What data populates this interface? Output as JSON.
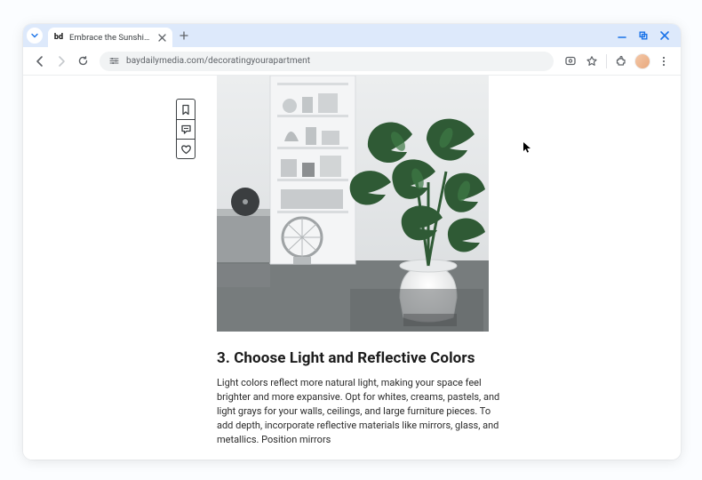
{
  "browser": {
    "tab_title": "Embrace the Sunshine: Dec…",
    "favicon_text": "bd",
    "url": "baydailymedia.com/decoratingyourapartment"
  },
  "side_actions": {
    "bookmark_label": "bookmark",
    "comment_label": "comment",
    "like_label": "like"
  },
  "article": {
    "heading": "3. Choose Light and Reflective Colors",
    "body": "Light colors reflect more natural light, making your space feel brighter and more expansive. Opt for whites, creams, pastels, and light grays for your walls, ceilings, and large furniture pieces. To add depth, incorporate reflective materials like mirrors, glass, and metallics. Position mirrors"
  }
}
